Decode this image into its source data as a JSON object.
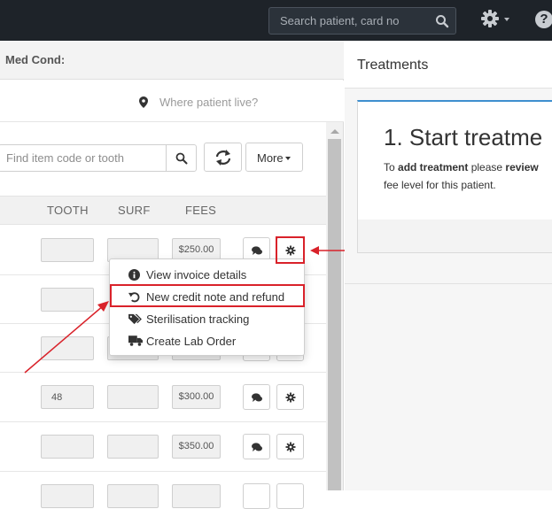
{
  "navbar": {
    "search_placeholder": "Search patient, card no",
    "icons": [
      "search-icon",
      "gear-icon",
      "help-icon"
    ],
    "help_glyph": "?"
  },
  "patient": {
    "med_cond_label": "Med Cond:",
    "location_placeholder": "Where patient live?"
  },
  "toolbar": {
    "item_placeholder": "Find item code or tooth",
    "more_label": "More"
  },
  "table": {
    "headers": {
      "tooth": "TOOTH",
      "surf": "SURF",
      "fees": "FEES"
    },
    "rows": [
      {
        "tooth": "",
        "surf": "",
        "fee": "$250.00"
      },
      {
        "tooth": "",
        "surf": "",
        "fee": ""
      },
      {
        "tooth": "",
        "surf": "",
        "fee": ""
      },
      {
        "tooth": "48",
        "surf": "",
        "fee": "$300.00"
      },
      {
        "tooth": "",
        "surf": "",
        "fee": "$350.00"
      },
      {
        "tooth": "",
        "surf": "",
        "fee": ""
      }
    ]
  },
  "dropdown": {
    "items": [
      {
        "label": "View invoice details",
        "icon": "info-circle-icon"
      },
      {
        "label": "New credit note and refund",
        "icon": "undo-icon"
      },
      {
        "label": "Sterilisation tracking",
        "icon": "tags-icon"
      },
      {
        "label": "Create Lab Order",
        "icon": "truck-icon"
      }
    ]
  },
  "treatments": {
    "title": "Treatments",
    "heading": "1. Start treatme",
    "desc_prefix": "To ",
    "desc_bold1": "add treatment",
    "desc_mid": " please ",
    "desc_bold2": "review",
    "desc_line2": "fee level for this patient."
  },
  "colors": {
    "navbar": "#1e2329",
    "annotation_red": "#d9222a",
    "card_accent": "#3e8fcf"
  }
}
